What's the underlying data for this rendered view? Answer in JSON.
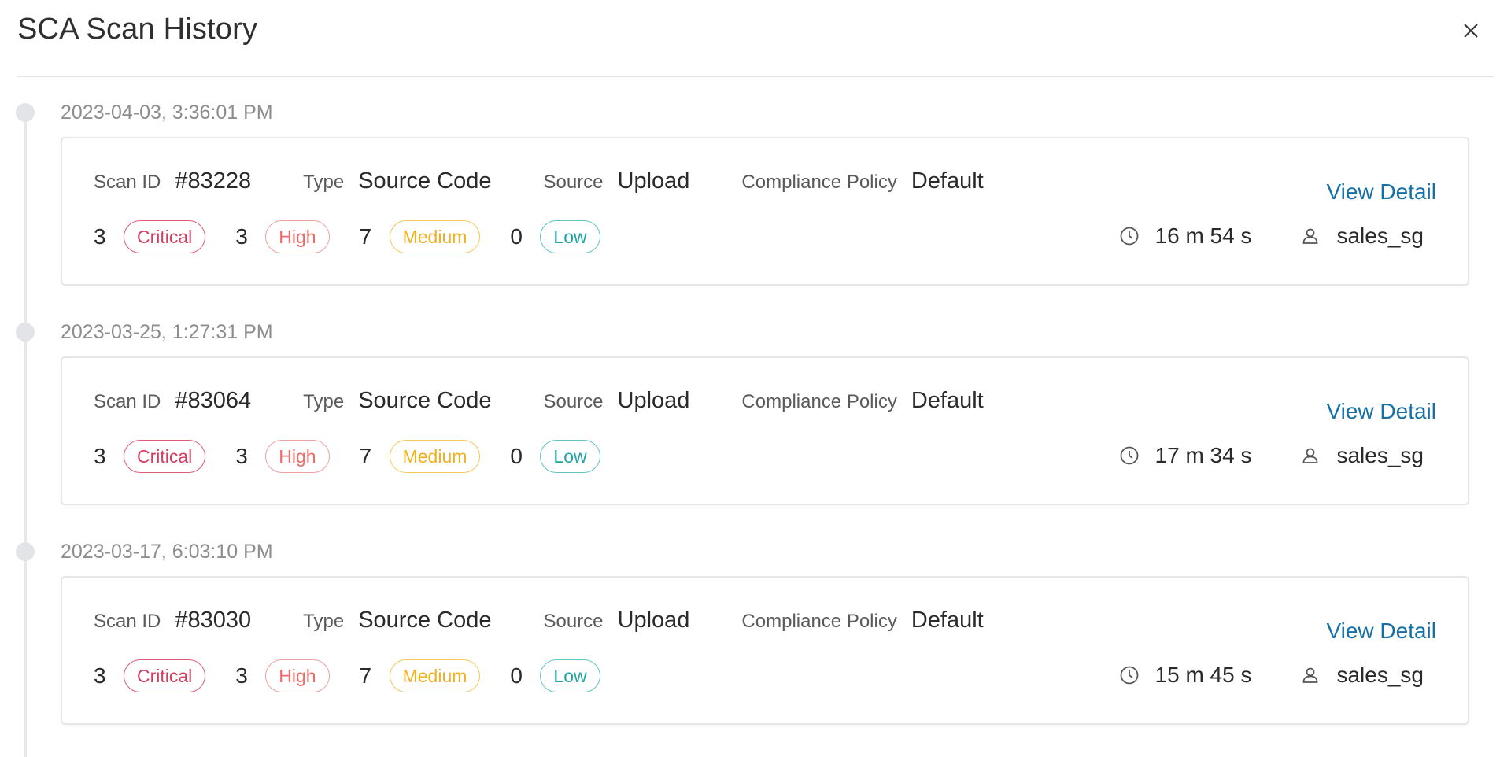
{
  "header": {
    "title": "SCA Scan History"
  },
  "labels": {
    "scan_id": "Scan ID",
    "type": "Type",
    "source": "Source",
    "compliance_policy": "Compliance Policy",
    "view_detail": "View Detail",
    "critical": "Critical",
    "high": "High",
    "medium": "Medium",
    "low": "Low"
  },
  "colors": {
    "critical": "#d83b5d",
    "high": "#ef6a6a",
    "medium": "#f0b020",
    "low": "#1fa6a3",
    "link": "#1570a6"
  },
  "scans": [
    {
      "date": "2023-04-03, 3:36:01 PM",
      "scan_id": "#83228",
      "type": "Source Code",
      "source": "Upload",
      "policy": "Default",
      "critical": "3",
      "high": "3",
      "medium": "7",
      "low": "0",
      "duration": "16 m 54 s",
      "user": "sales_sg"
    },
    {
      "date": "2023-03-25, 1:27:31 PM",
      "scan_id": "#83064",
      "type": "Source Code",
      "source": "Upload",
      "policy": "Default",
      "critical": "3",
      "high": "3",
      "medium": "7",
      "low": "0",
      "duration": "17 m 34 s",
      "user": "sales_sg"
    },
    {
      "date": "2023-03-17, 6:03:10 PM",
      "scan_id": "#83030",
      "type": "Source Code",
      "source": "Upload",
      "policy": "Default",
      "critical": "3",
      "high": "3",
      "medium": "7",
      "low": "0",
      "duration": "15 m 45 s",
      "user": "sales_sg"
    }
  ]
}
